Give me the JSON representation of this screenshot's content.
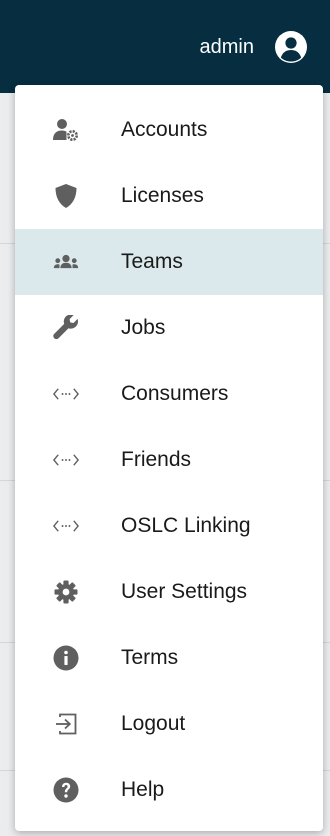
{
  "header": {
    "user_label": "admin"
  },
  "menu": {
    "items": [
      {
        "label": "Accounts",
        "icon": "accounts-icon"
      },
      {
        "label": "Licenses",
        "icon": "shield-icon"
      },
      {
        "label": "Teams",
        "icon": "users-icon",
        "active": true
      },
      {
        "label": "Jobs",
        "icon": "wrench-icon"
      },
      {
        "label": "Consumers",
        "icon": "code-icon"
      },
      {
        "label": "Friends",
        "icon": "code-icon"
      },
      {
        "label": "OSLC Linking",
        "icon": "code-icon"
      },
      {
        "label": "User Settings",
        "icon": "gear-icon"
      },
      {
        "label": "Terms",
        "icon": "info-icon"
      },
      {
        "label": "Logout",
        "icon": "logout-icon"
      },
      {
        "label": "Help",
        "icon": "help-icon"
      }
    ]
  },
  "colors": {
    "header_bg": "#062e40",
    "active_bg": "#dbe9ec",
    "icon": "#5f5f5f"
  }
}
